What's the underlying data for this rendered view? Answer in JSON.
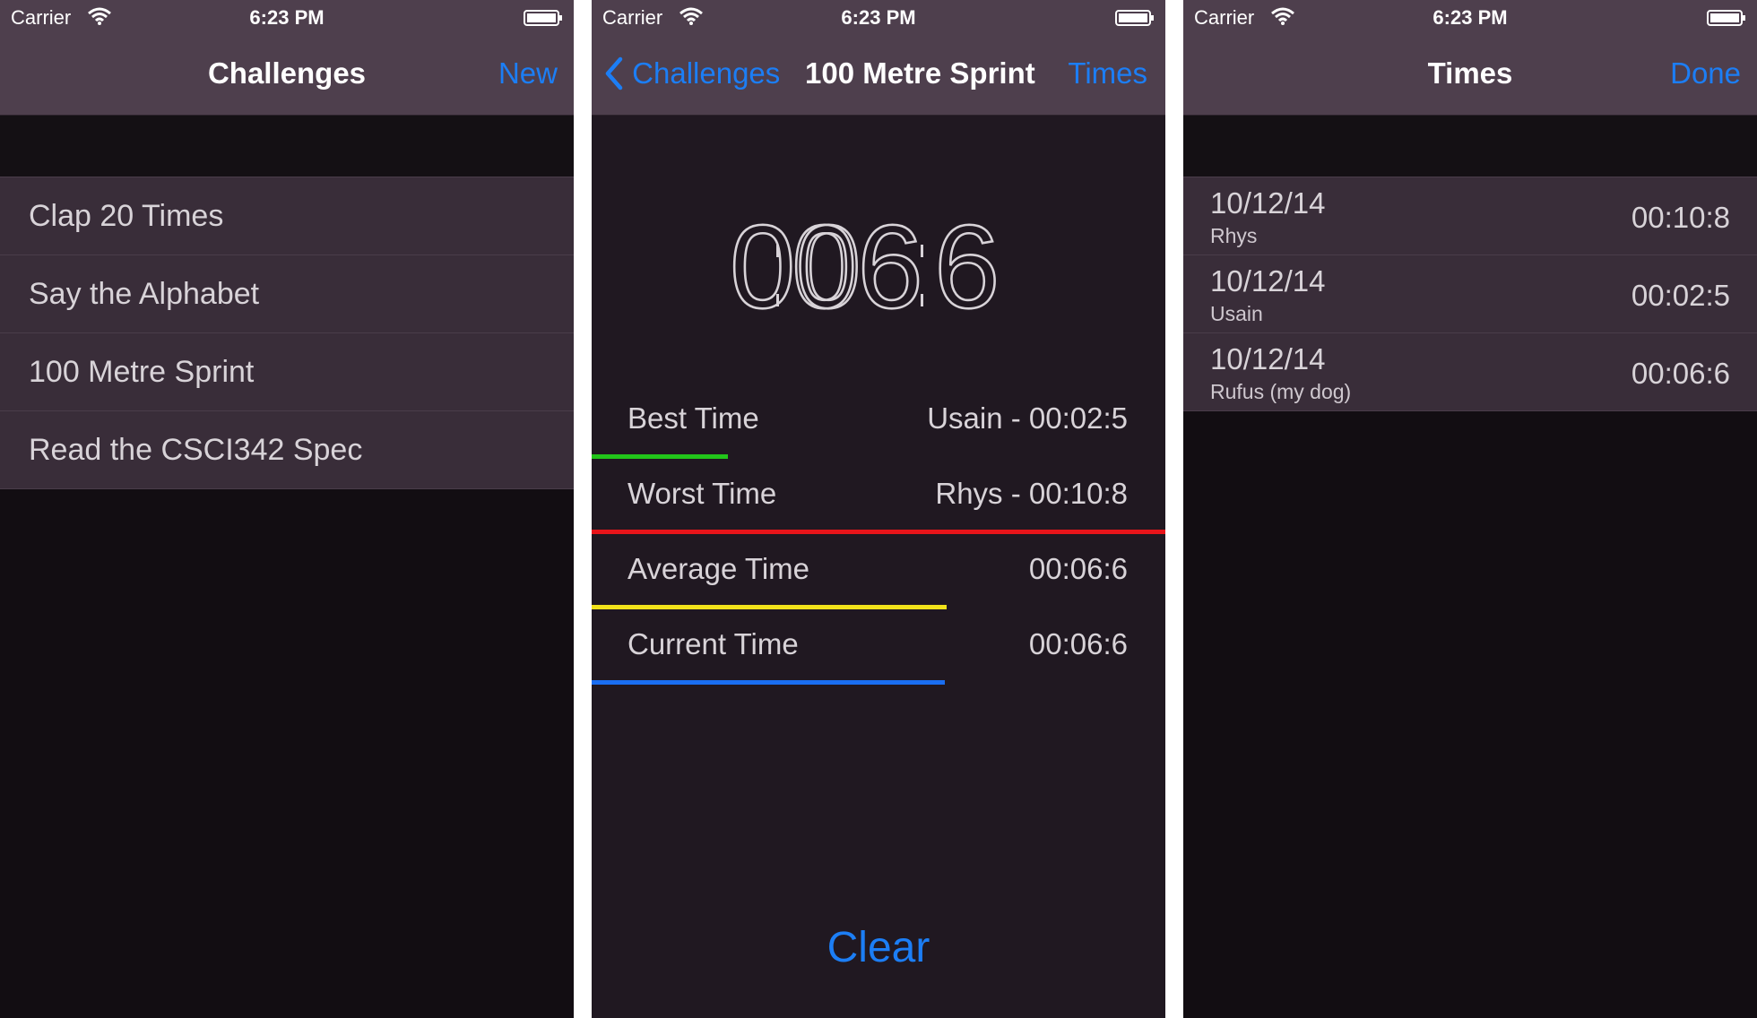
{
  "status": {
    "carrier": "Carrier",
    "time": "6:23 PM"
  },
  "screen1": {
    "title": "Challenges",
    "new_label": "New",
    "items": [
      {
        "label": "Clap 20 Times"
      },
      {
        "label": "Say the Alphabet"
      },
      {
        "label": "100 Metre Sprint"
      },
      {
        "label": "Read the CSCI342 Spec"
      }
    ]
  },
  "screen2": {
    "back_label": "Challenges",
    "title": "100 Metre Sprint",
    "times_label": "Times",
    "timer": {
      "minutes": "00",
      "seconds": "06",
      "tenths": "6"
    },
    "stats": [
      {
        "label": "Best Time",
        "value": "Usain - 00:02:5",
        "color": "#22c51a"
      },
      {
        "label": "Worst Time",
        "value": "Rhys - 00:10:8",
        "color": "#e8141a"
      },
      {
        "label": "Average Time",
        "value": "00:06:6",
        "color": "#f2e21a"
      },
      {
        "label": "Current Time",
        "value": "00:06:6",
        "color": "#1a6ef2"
      }
    ],
    "clear_label": "Clear"
  },
  "screen3": {
    "title": "Times",
    "done_label": "Done",
    "rows": [
      {
        "date": "10/12/14",
        "name": "Rhys",
        "time": "00:10:8"
      },
      {
        "date": "10/12/14",
        "name": "Usain",
        "time": "00:02:5"
      },
      {
        "date": "10/12/14",
        "name": "Rufus (my dog)",
        "time": "00:06:6"
      }
    ]
  },
  "colors": {
    "accent": "#1c7ef5",
    "navbar": "#4e3f4d",
    "background": "#120d12",
    "cell": "#392d39"
  }
}
